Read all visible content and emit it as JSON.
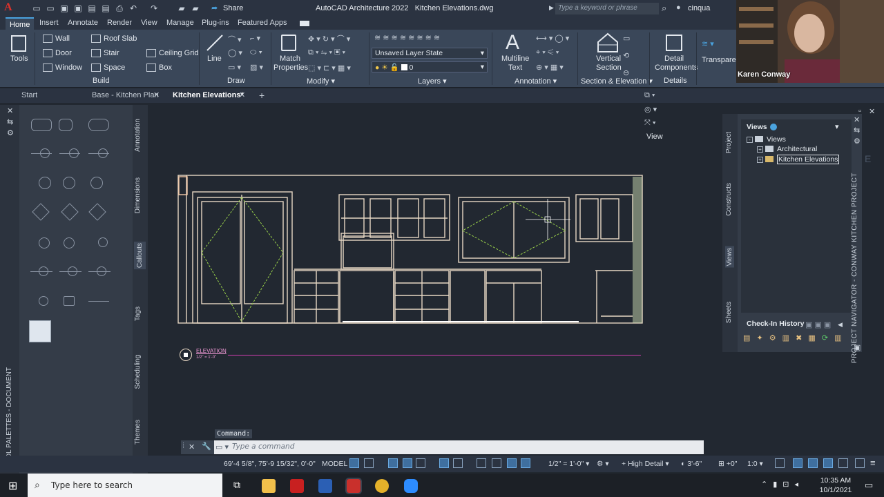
{
  "window": {
    "app_title": "AutoCAD Architecture 2022",
    "file_name": "Kitchen Elevations.dwg",
    "search_placeholder": "Type a keyword or phrase",
    "user": "cinqua",
    "share_label": "Share"
  },
  "ribbon_tabs": [
    "Home",
    "Insert",
    "Annotate",
    "Render",
    "View",
    "Manage",
    "Plug-ins",
    "Featured Apps"
  ],
  "ribbon": {
    "tools_label": "Tools",
    "build": {
      "title": "Build",
      "items": [
        "Wall",
        "Door",
        "Window",
        "Roof Slab",
        "Stair",
        "Space",
        "Ceiling Grid",
        "Box"
      ]
    },
    "draw": {
      "title": "Draw",
      "line_label": "Line"
    },
    "modify": {
      "title": "Modify",
      "match_label": "Match",
      "properties_label": "Properties"
    },
    "layers": {
      "title": "Layers",
      "layer_state": "Unsaved Layer State",
      "current_layer": "0"
    },
    "annotation": {
      "title": "Annotation",
      "multiline_label": "Multiline",
      "text_label": "Text"
    },
    "section_elevation": {
      "title": "Section & Elevation",
      "vertical_label": "Vertical",
      "section_label": "Section"
    },
    "details": {
      "title": "Details",
      "detail_label": "Detail",
      "components_label": "Components"
    },
    "transparency": {
      "label": "Transparenc"
    }
  },
  "doc_tabs": [
    {
      "label": "Start"
    },
    {
      "label": "Base - Kitchen Plan"
    },
    {
      "label": "Kitchen Elevations*"
    }
  ],
  "tool_palette": {
    "vertical_title": "TOOL PALETTES - DOCUMENT",
    "tabs": [
      "Annotation",
      "Dimensions",
      "Callouts",
      "Tags",
      "Scheduling",
      "Themes"
    ],
    "active_tab": "Callouts"
  },
  "view_toolbar_label": "View",
  "drawing": {
    "elevation_tag_title": "ELEVATION",
    "elevation_tag_scale": "1/2\" = 1'-0\""
  },
  "project_navigator": {
    "vertical_title": "PROJECT NAVIGATOR - CONWAY KITCHEN PROJECT",
    "tabs": [
      "Project",
      "Constructs",
      "Views",
      "Sheets"
    ],
    "active_tab": "Views",
    "views_header": "Views",
    "tree": [
      "Views",
      "Architectural",
      "Kitchen Elevations"
    ],
    "check_in_history": "Check-In History"
  },
  "command": {
    "label": "Command:",
    "placeholder": "Type a command"
  },
  "status_bar": {
    "coordinates": "69'-4 5/8\", 75'-9 15/32\", 0'-0\"",
    "model": "MODEL",
    "scale": "1/2\" = 1'-0\"",
    "detail": "High Detail",
    "cut_plane": "3'-6\"",
    "elevation": "+0\"",
    "ratio": "1:0"
  },
  "taskbar": {
    "search_placeholder": "Type here to search",
    "time": "10:35 AM",
    "date": "10/1/2021"
  },
  "webcam": {
    "name": "Karen Conway"
  }
}
